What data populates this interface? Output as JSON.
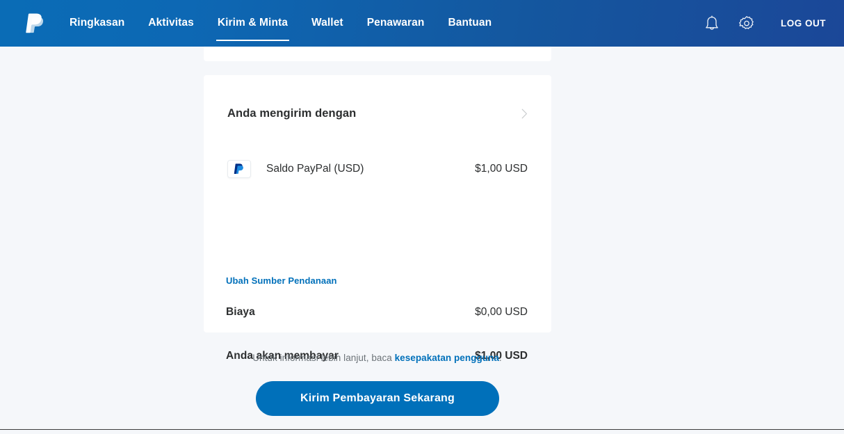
{
  "header": {
    "logo": "paypal-logo-icon",
    "nav": [
      {
        "label": "Ringkasan",
        "active": false
      },
      {
        "label": "Aktivitas",
        "active": false
      },
      {
        "label": "Kirim & Minta",
        "active": true
      },
      {
        "label": "Wallet",
        "active": false
      },
      {
        "label": "Penawaran",
        "active": false
      },
      {
        "label": "Bantuan",
        "active": false
      }
    ],
    "notifications_icon": "bell-icon",
    "settings_icon": "gear-icon",
    "logout_label": "LOG OUT"
  },
  "card": {
    "heading": "Anda mengirim dengan",
    "expand_icon": "chevron-right-icon",
    "funding": {
      "logo": "paypal-logo-icon",
      "label": "Saldo PayPal (USD)",
      "amount": "$1,00 USD"
    },
    "change_funding_label": "Ubah Sumber Pendanaan",
    "fee": {
      "label": "Biaya",
      "amount": "$0,00 USD"
    },
    "total": {
      "label": "Anda akan membayar",
      "amount": "$1,00 USD"
    }
  },
  "footer": {
    "note_prefix": "Untuk informasi lebih lanjut, baca ",
    "note_link": "kesepakatan pengguna",
    "note_suffix": ".",
    "cta_label": "Kirim Pembayaran Sekarang"
  },
  "colors": {
    "brand_blue": "#0070ba",
    "header_gradient_start": "#0a6cb6",
    "header_gradient_end": "#1b4798",
    "page_background": "#f5f7fa",
    "text_dark": "#2c2e2f",
    "text_muted": "#6c7378"
  }
}
